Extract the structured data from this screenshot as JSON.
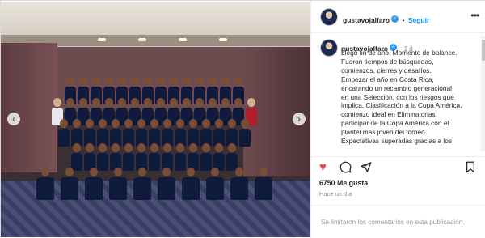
{
  "post": {
    "username": "gustavojalfaro",
    "follow_label": "Seguir",
    "separator": "•",
    "more_label": "•••",
    "time_ago": "1 d",
    "caption_lines": [
      "Llegó fin de año. Momento de balance.",
      "Fueron tiempos de búsquedas,",
      "comienzos, cierres y desafíos.",
      "Empezar el año en Costa Rica,",
      "encarando un recambio generacional",
      "en una Selección, con los riesgos que",
      "implica. Clasificación a la Copa América,",
      "comienzo ideal en Eliminatorias,",
      "participar de la Copa América con el",
      "plantel más joven del torneo.",
      "Expectativas superadas gracias a los"
    ],
    "likes": "6750 Me gusta",
    "posted_ago": "Hace un día",
    "comments_disabled": "Se limitaron los comentarios en esta publicación."
  },
  "carousel": {
    "prev_label": "‹",
    "next_label": "›"
  },
  "icons": {
    "like": "heart-filled-icon",
    "comment": "comment-icon",
    "share": "send-icon",
    "save": "bookmark-icon",
    "verified": "verified-badge-icon",
    "more": "more-options-icon"
  },
  "colors": {
    "like": "#ed4956",
    "follow": "#0095f6",
    "verified": "#3897f0",
    "muted": "#8e8e8e"
  }
}
